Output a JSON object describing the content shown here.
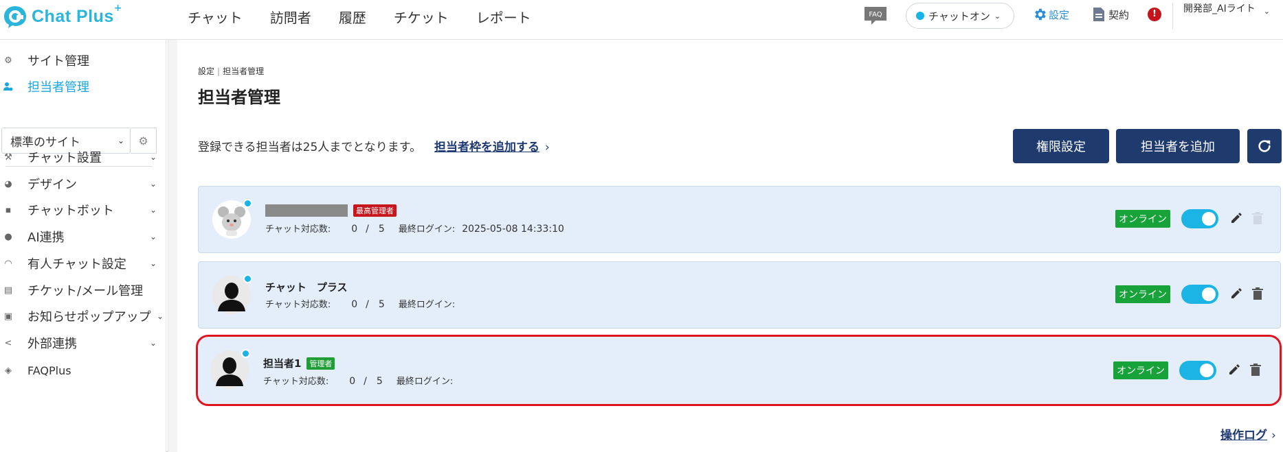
{
  "brand": {
    "name": "Chat Plus",
    "plus_mark": "+"
  },
  "topnav": {
    "items": [
      "チャット",
      "訪問者",
      "履歴",
      "チケット",
      "レポート"
    ],
    "faq_label": "FAQ",
    "chat_status": "チャットオン",
    "settings_label": "設定",
    "contract_label": "契約",
    "alert_glyph": "!",
    "user_name": "開発部_AIライト"
  },
  "sidebar": {
    "top_items": [
      {
        "label": "サイト管理",
        "icon": "gear-icon",
        "active": false
      },
      {
        "label": "担当者管理",
        "icon": "user-gear-icon",
        "active": true
      }
    ],
    "site_select": "標準のサイト",
    "sections": [
      {
        "label": "チャット設置",
        "icon": "tools-icon"
      },
      {
        "label": "デザイン",
        "icon": "palette-icon"
      },
      {
        "label": "チャットボット",
        "icon": "chat-bubble-icon"
      },
      {
        "label": "AI連携",
        "icon": "bulb-icon"
      },
      {
        "label": "有人チャット設定",
        "icon": "headset-icon"
      },
      {
        "label": "チケット/メール管理",
        "icon": "list-icon"
      },
      {
        "label": "お知らせポップアップ",
        "icon": "window-icon"
      },
      {
        "label": "外部連携",
        "icon": "share-icon"
      },
      {
        "label": "FAQPlus",
        "icon": "shield-icon"
      }
    ]
  },
  "main": {
    "breadcrumb": [
      "設定",
      "担当者管理"
    ],
    "title": "担当者管理",
    "limit_text": "登録できる担当者は25人までとなります。",
    "add_slot_link": "担当者枠を追加する",
    "permission_button": "権限設定",
    "add_staff_button": "担当者を追加",
    "refresh_icon": "refresh-icon",
    "chat_count_label": "チャット対応数:",
    "last_login_label": "最終ログイン:",
    "staff": [
      {
        "name": "",
        "role": "最高管理者",
        "current": "0",
        "max": "5",
        "last_login": "2025-05-08 14:33:10",
        "status": "オンライン",
        "online": true
      },
      {
        "name": "チャット　プラス",
        "role": "",
        "current": "0",
        "max": "5",
        "last_login": "",
        "status": "オンライン",
        "online": true
      },
      {
        "name": "担当者1",
        "role": "管理者",
        "current": "0",
        "max": "5",
        "last_login": "",
        "status": "オンライン",
        "online": true
      }
    ],
    "operation_log_link": "操作ログ"
  },
  "colors": {
    "brand": "#2bb5dc",
    "primary_button": "#1f3b6e",
    "card_bg": "#e3eefa",
    "online_badge": "#17a23a",
    "toggle_on": "#1cb3e5",
    "highlight_border": "#e0141e",
    "super_admin_badge": "#c8161d",
    "admin_badge": "#1f9d37"
  }
}
